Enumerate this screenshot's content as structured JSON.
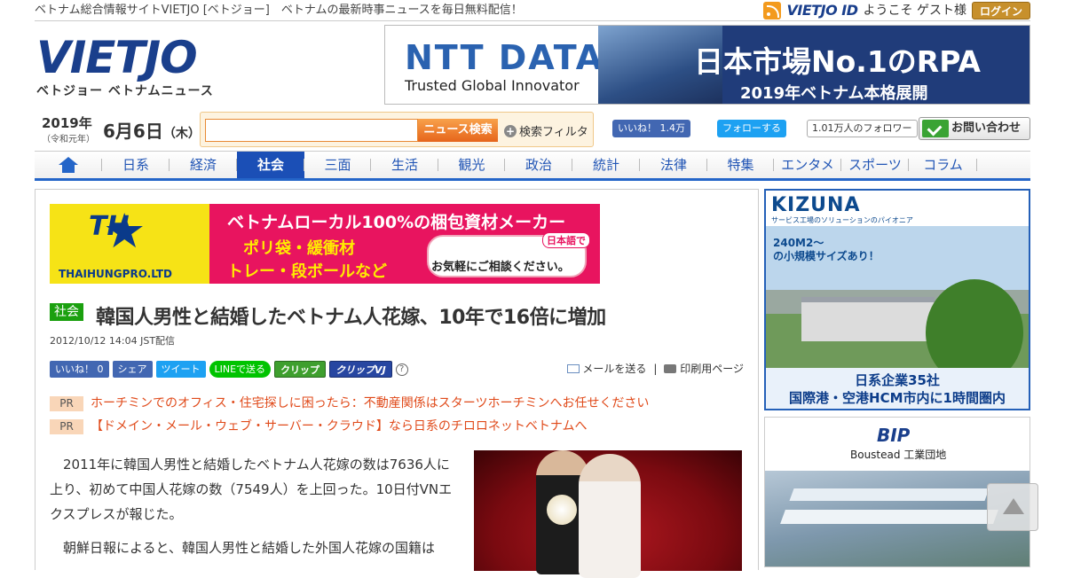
{
  "topbar": {
    "tagline": "ベトナム総合情報サイトVIETJO [ベトジョー]　ベトナムの最新時事ニュースを毎日無料配信！",
    "vietjo_id": "VIETJO ID",
    "welcome": "ようこそ ゲスト様",
    "login": "ログイン"
  },
  "logo": {
    "main": "VIETJO",
    "sub": "ベトジョー ベトナムニュース"
  },
  "top_banner": {
    "brand": "NTT DATA",
    "slogan": "Trusted Global Innovator",
    "headline": "日本市場No.1のRPA",
    "subline": "2019年ベトナム本格展開"
  },
  "date": {
    "year": "2019年",
    "era": "（令和元年）",
    "day": "6月6日",
    "weekday": "（木）"
  },
  "search": {
    "placeholder": "",
    "button": "ニュース検索",
    "filter": "検索フィルタ"
  },
  "social": {
    "fb": "いいね！ 1.4万",
    "tw": "フォローする",
    "followers": "1.01万人のフォロワー",
    "contact": "お問い合わせ"
  },
  "nav": {
    "items": [
      "日系",
      "経済",
      "社会",
      "三面",
      "生活",
      "観光",
      "政治",
      "統計",
      "法律",
      "特集",
      "エンタメ",
      "スポーツ",
      "コラム"
    ],
    "active": "社会"
  },
  "ad": {
    "headline": "ベトナムローカル100%の梱包資材メーカー",
    "line1": "ポリ袋・緩衝材",
    "line2": "トレー・段ボールなど",
    "bubble1": "日本語で",
    "bubble2": "お気軽にご相談ください。",
    "brand": "TH",
    "brand_full": "THAIHUNGPRO.LTD"
  },
  "article": {
    "category": "社会",
    "title": "韓国人男性と結婚したベトナム人花嫁、10年で16倍に増加",
    "date": "2012/10/12 14:04 JST配信",
    "paragraph1": "2011年に韓国人男性と結婚したベトナム人花嫁の数は7636人に上り、初めて中国人花嫁の数（7549人）を上回った。10日付VNエクスプレスが報じた。",
    "paragraph2": "朝鮮日報によると、韓国人男性と結婚した外国人花嫁の国籍は"
  },
  "share": {
    "like": "いいね！ 0",
    "share": "シェア",
    "tweet": "ツイート",
    "line": "LINEで送る",
    "clip": "クリップ",
    "clip_vj": "クリップVJ",
    "help": "?",
    "mail": "メールを送る",
    "sep": "|",
    "print": "印刷用ページ"
  },
  "pr": [
    {
      "label": "PR",
      "text": "ホーチミンでのオフィス・住宅探しに困ったら：不動産関係はスターツホーチミンへお任せください"
    },
    {
      "label": "PR",
      "text": "【ドメイン・メール・ウェブ・サーバー・クラウド】なら日系のチロロネットベトナムへ"
    }
  ],
  "side_ad1": {
    "brand": "KIZUNA",
    "tag": "サービス工場のソリューションのパイオニア",
    "size1": "240M2～",
    "size2": "の小規模サイズあり！",
    "foot1": "日系企業35社",
    "foot2": "国際港・空港HCM市内に1時間圏内"
  },
  "side_ad2": {
    "brand": "BIP",
    "name": "Boustead 工業団地"
  }
}
